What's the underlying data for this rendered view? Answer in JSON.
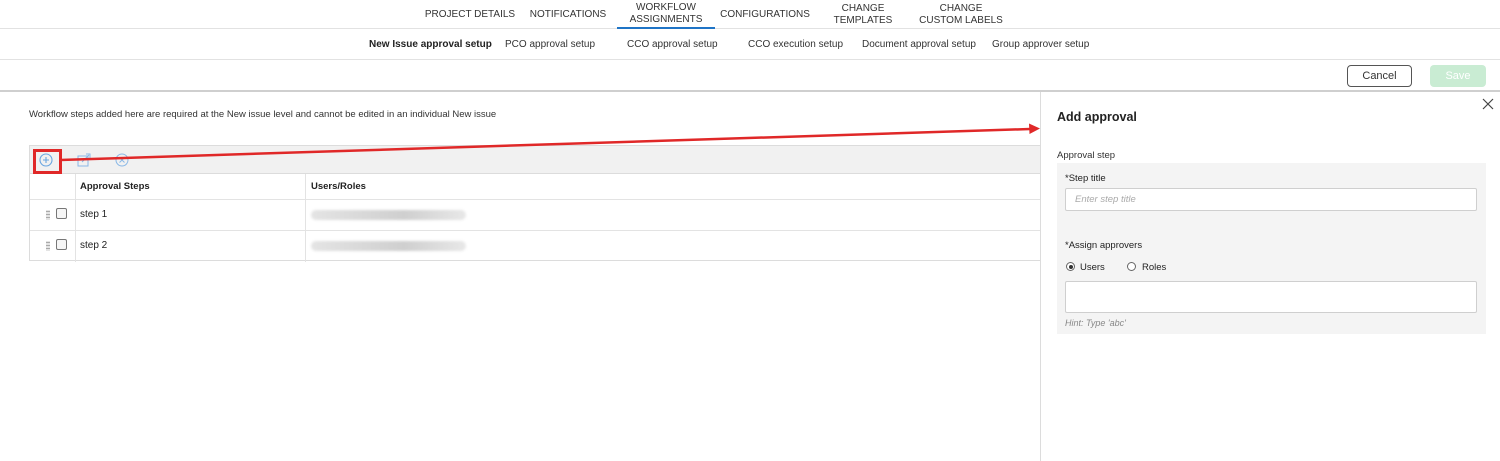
{
  "top_tabs": [
    {
      "label": "PROJECT DETAILS"
    },
    {
      "label": "NOTIFICATIONS"
    },
    {
      "label": "WORKFLOW ASSIGNMENTS",
      "active": true
    },
    {
      "label": "CONFIGURATIONS"
    },
    {
      "label": "CHANGE TEMPLATES"
    },
    {
      "label": "CHANGE CUSTOM LABELS"
    }
  ],
  "sub_tabs": [
    {
      "label": "New Issue approval setup",
      "active": true
    },
    {
      "label": "PCO approval setup"
    },
    {
      "label": "CCO approval setup"
    },
    {
      "label": "CCO execution setup"
    },
    {
      "label": "Document approval setup"
    },
    {
      "label": "Group approver setup"
    }
  ],
  "actions": {
    "cancel": "Cancel",
    "save": "Save"
  },
  "notice": "Workflow steps added here are required at the New issue level and cannot be edited in an individual New issue",
  "grid": {
    "toolbar_icons": [
      "add-icon",
      "edit-icon",
      "delete-icon"
    ],
    "headers": {
      "steps": "Approval Steps",
      "users": "Users/Roles"
    },
    "rows": [
      {
        "step": "step 1"
      },
      {
        "step": "step 2"
      }
    ]
  },
  "panel": {
    "title": "Add approval",
    "section": "Approval step",
    "step_title_label": "*Step title",
    "step_title_placeholder": "Enter step title",
    "assign_label": "*Assign approvers",
    "radio_users": "Users",
    "radio_roles": "Roles",
    "selected": "Users",
    "approvers_value": "",
    "hint": "Hint: Type 'abc'"
  },
  "colors": {
    "accent": "#1f74c6",
    "annotation": "#e02828",
    "save_disabled": "#c9ecd3"
  }
}
